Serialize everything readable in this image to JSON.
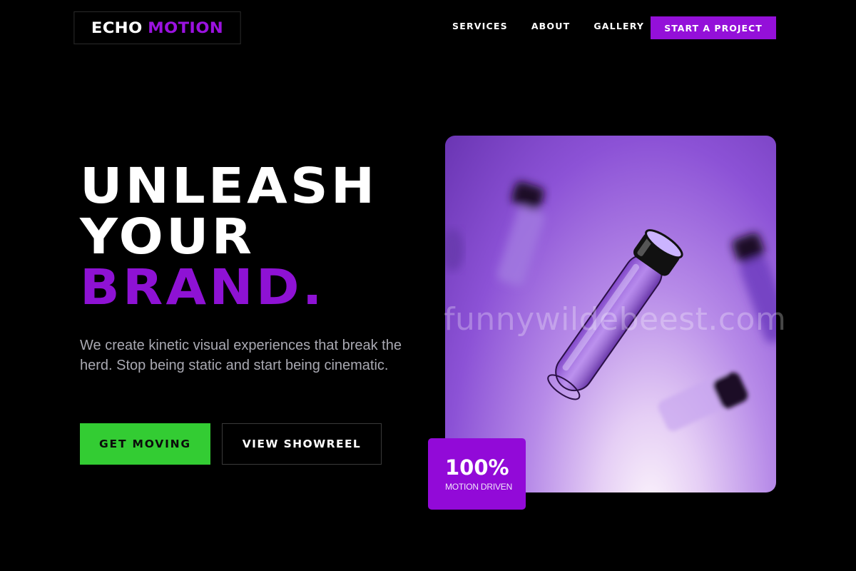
{
  "brand": {
    "word1": "ECHO",
    "word2": "MOTION"
  },
  "nav": {
    "items": [
      "SERVICES",
      "ABOUT",
      "GALLERY"
    ],
    "cta": "START A PROJECT"
  },
  "hero": {
    "headline": [
      "UNLEASH",
      "YOUR",
      "BRAND."
    ],
    "description": "We create kinetic visual experiences that break the herd. Stop being static and start being cinematic.",
    "primary_button": "GET MOVING",
    "secondary_button": "VIEW SHOWREEL"
  },
  "media": {
    "watermark": "funnywildebeest.com",
    "stat_value": "100%",
    "stat_label": "MOTION DRIVEN"
  },
  "colors": {
    "background": "#000000",
    "accent_purple": "#9410d9",
    "accent_green": "#33cc33",
    "body_text": "#a9a9b2"
  }
}
